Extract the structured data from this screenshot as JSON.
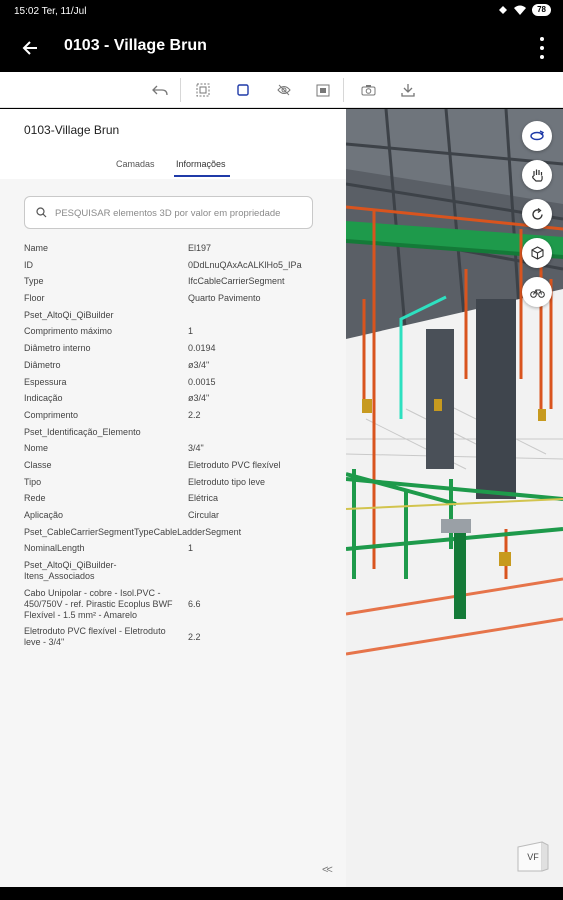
{
  "status": {
    "time": "15:02 Ter, 11/Jul",
    "battery": "78"
  },
  "appbar": {
    "title": "0103 - Village Brun"
  },
  "panel": {
    "title": "0103-Village Brun",
    "tabs": [
      {
        "label": "Camadas"
      },
      {
        "label": "Informações"
      }
    ],
    "search_placeholder": "PESQUISAR elementos 3D por valor em propriedade",
    "properties": [
      {
        "k": "Name",
        "v": "El197"
      },
      {
        "k": "ID",
        "v": "0DdLnuQAxAcALKlHo5_IPa"
      },
      {
        "k": "Type",
        "v": "IfcCableCarrierSegment"
      },
      {
        "k": "Floor",
        "v": "Quarto Pavimento"
      },
      {
        "k": "Pset_AltoQi_QiBuilder",
        "v": ""
      },
      {
        "k": "Comprimento máximo",
        "v": "1"
      },
      {
        "k": "Diâmetro interno",
        "v": "0.0194"
      },
      {
        "k": "Diâmetro",
        "v": "ø3/4\""
      },
      {
        "k": "Espessura",
        "v": "0.0015"
      },
      {
        "k": "Indicação",
        "v": "ø3/4\""
      },
      {
        "k": "Comprimento",
        "v": "2.2"
      },
      {
        "k": "Pset_Identificação_Elemento",
        "v": ""
      },
      {
        "k": "Nome",
        "v": "3/4\""
      },
      {
        "k": "Classe",
        "v": "Eletroduto PVC flexível"
      },
      {
        "k": "Tipo",
        "v": "Eletroduto tipo leve"
      },
      {
        "k": "Rede",
        "v": "Elétrica"
      },
      {
        "k": "Aplicação",
        "v": "Circular"
      },
      {
        "k": "Pset_CableCarrierSegmentTypeCableLadderSegment",
        "v": ""
      },
      {
        "k": "NominalLength",
        "v": "1"
      },
      {
        "k": "Pset_AltoQi_QiBuilder-Itens_Associados",
        "v": ""
      },
      {
        "k": "Cabo Unipolar - cobre - Isol.PVC - 450/750V - ref. Pirastic Ecoplus BWF Flexível - 1.5 mm² - Amarelo",
        "v": "6.6"
      },
      {
        "k": "Eletroduto PVC flexível - Eletroduto leve - 3/4\"",
        "v": "2.2"
      }
    ]
  },
  "viewport": {
    "corner_label": "VF"
  },
  "colors": {
    "accent": "#1f3aa8",
    "appbar": "#000000",
    "pipe_orange": "#d9541e",
    "pipe_green": "#1e9a4b",
    "selected_cyan": "#2ee0c0"
  }
}
